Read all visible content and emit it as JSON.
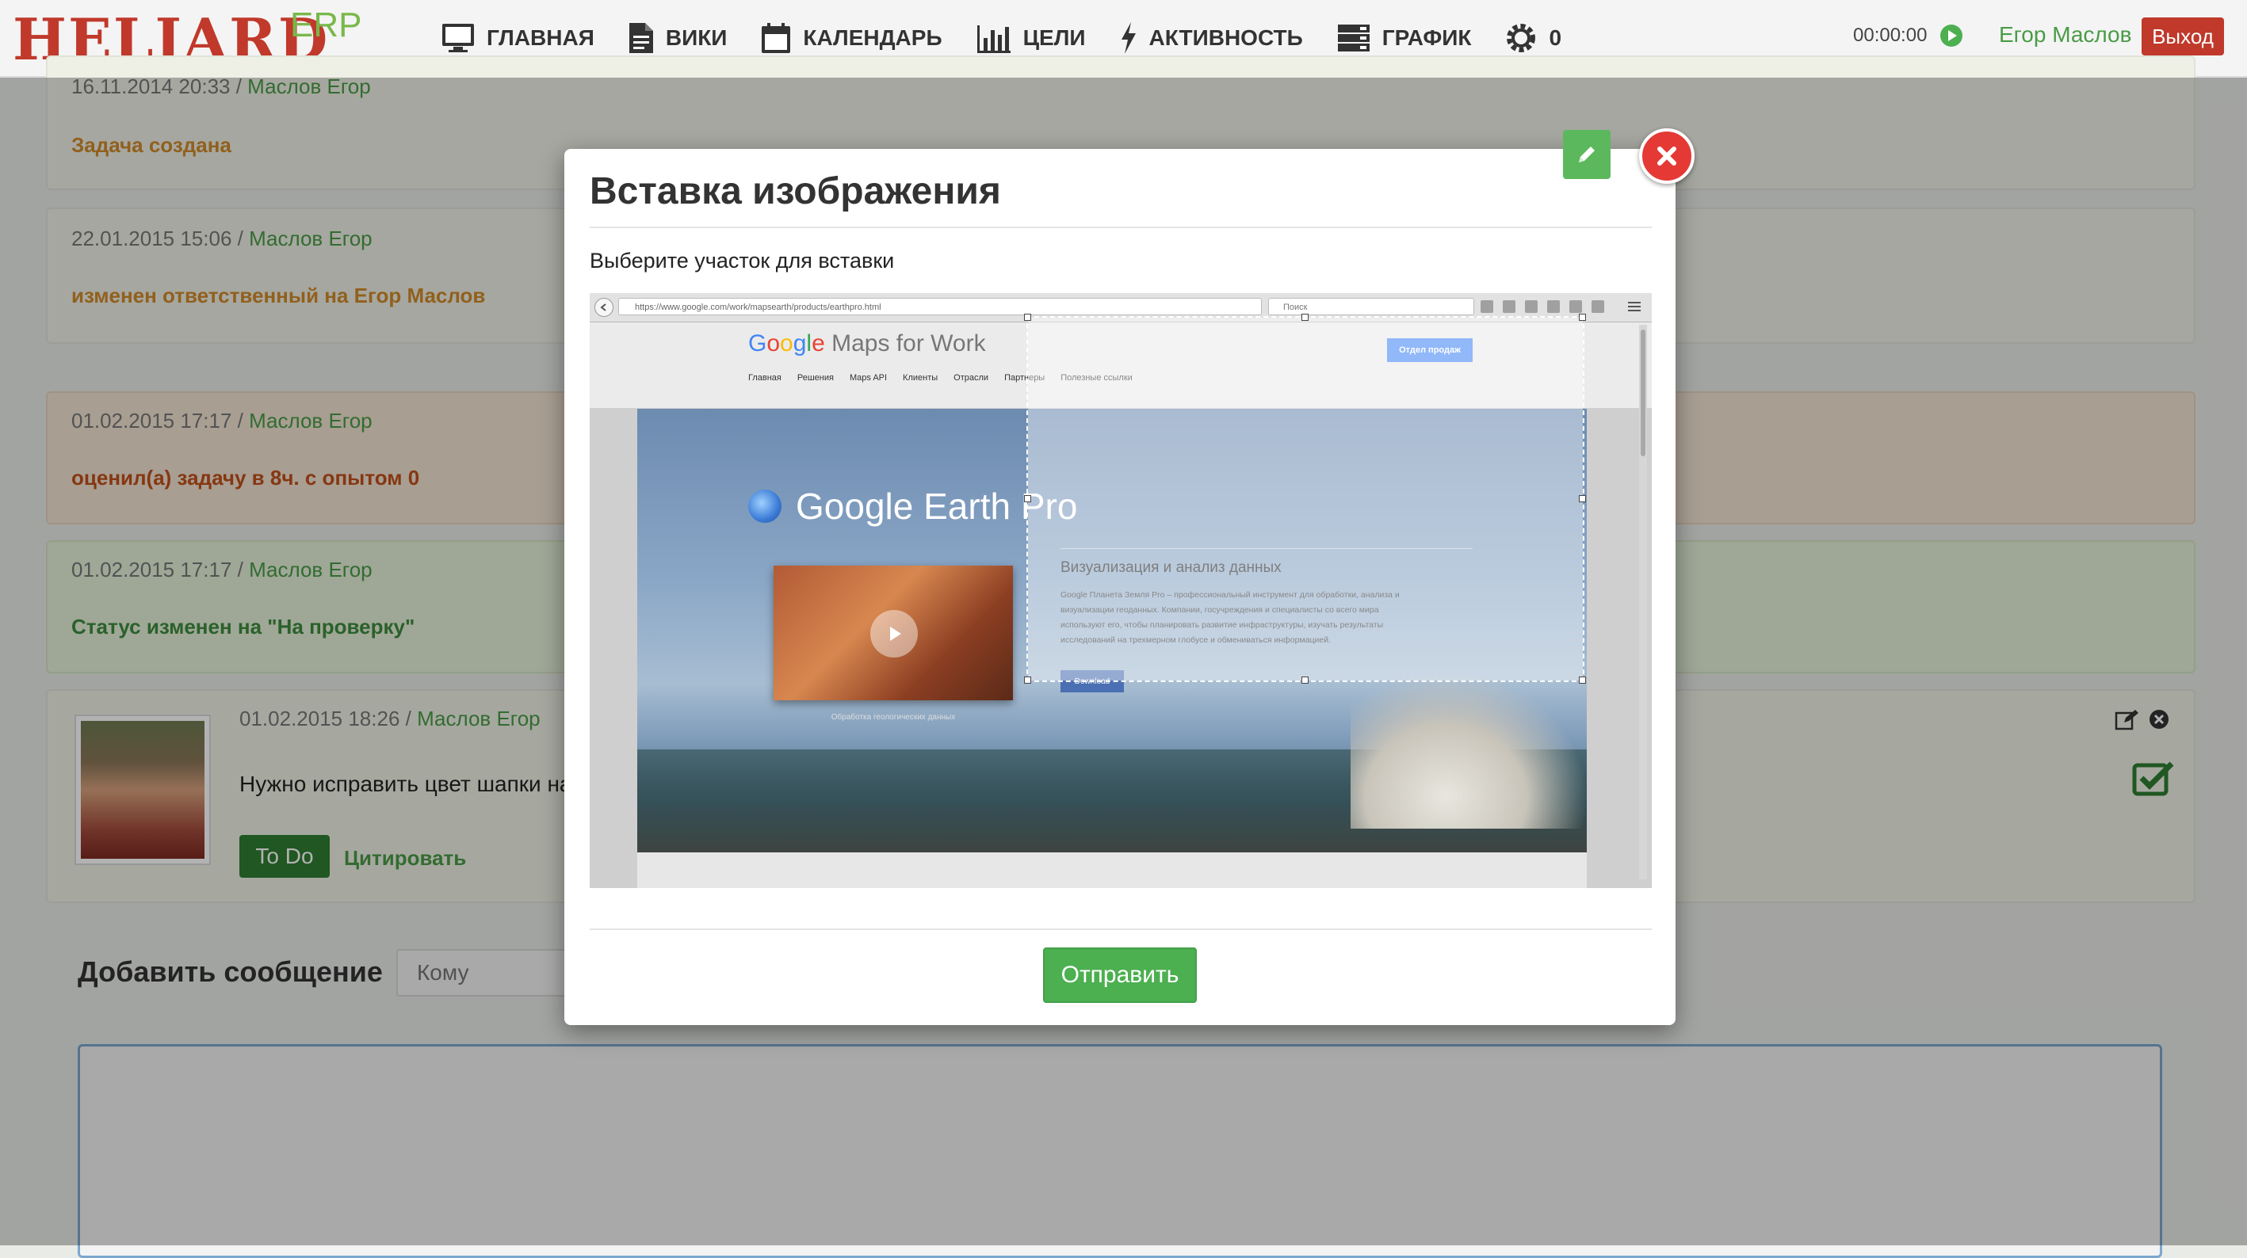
{
  "brand": {
    "logo": "HELIARD",
    "suffix": "ERP"
  },
  "nav": {
    "items": [
      {
        "label": "ГЛАВНАЯ",
        "icon": "monitor-icon"
      },
      {
        "label": "ВИКИ",
        "icon": "document-icon"
      },
      {
        "label": "КАЛЕНДАРЬ",
        "icon": "calendar-icon"
      },
      {
        "label": "ЦЕЛИ",
        "icon": "bar-chart-icon"
      },
      {
        "label": "АКТИВНОСТЬ",
        "icon": "lightning-icon"
      },
      {
        "label": "ГРАФИК",
        "icon": "server-icon"
      },
      {
        "label": "0",
        "icon": "gear-icon"
      }
    ],
    "timer": "00:00:00",
    "user": "Егор Маслов",
    "logout": "Выход"
  },
  "history": [
    {
      "date": "16.11.2014 20:33",
      "author": "Маслов Егор",
      "text": "Задача создана",
      "text_color": "#d08a2a"
    },
    {
      "date": "22.01.2015 15:06",
      "author": "Маслов Егор",
      "text": "изменен ответственный на Егор Маслов",
      "text_color": "#d08a2a"
    },
    {
      "date": "01.02.2015 17:17",
      "author": "Маслов Егор",
      "text": "оценил(а) задачу в 8ч. с опытом 0",
      "text_color": "#c0501b"
    },
    {
      "date": "01.02.2015 17:17",
      "author": "Маслов Егор",
      "text": "Статус изменен на \"На проверку\"",
      "text_color": "#3d8b3d"
    }
  ],
  "comment": {
    "date": "01.02.2015 18:26",
    "author": "Маслов Егор",
    "text": "Нужно исправить цвет шапки на с",
    "todo_label": "To Do",
    "quote_label": "Цитировать"
  },
  "add_message": {
    "title": "Добавить сообщение",
    "to_placeholder": "Кому"
  },
  "modal": {
    "title": "Вставка изображения",
    "hint": "Выберите участок для вставки",
    "send_label": "Отправить"
  },
  "screenshot": {
    "url": "https://www.google.com/work/mapsearth/products/earthpro.html",
    "search_placeholder": "Поиск",
    "brand_google": [
      "G",
      "o",
      "o",
      "g",
      "l",
      "e"
    ],
    "brand_rest": " Maps for Work",
    "nav": [
      "Главная",
      "Решения",
      "Maps API",
      "Клиенты",
      "Отрасли",
      "Партнеры",
      "Полезные ссылки"
    ],
    "sales_button": "Отдел продаж",
    "earth_title": "Google Earth Pro",
    "viz_title": "Визуализация и анализ данных",
    "viz_desc": "Google Планета Земля Pro – профессиональный инструмент для обработки, анализа и визуализации геоданных. Компании, госучреждения и специалисты со всего мира используют его, чтобы планировать развитие инфраструктуры, изучать результаты исследований на трехмерном глобусе и обмениваться информацией.",
    "download_label": "Download",
    "video_caption": "Обработка геологических данных"
  }
}
